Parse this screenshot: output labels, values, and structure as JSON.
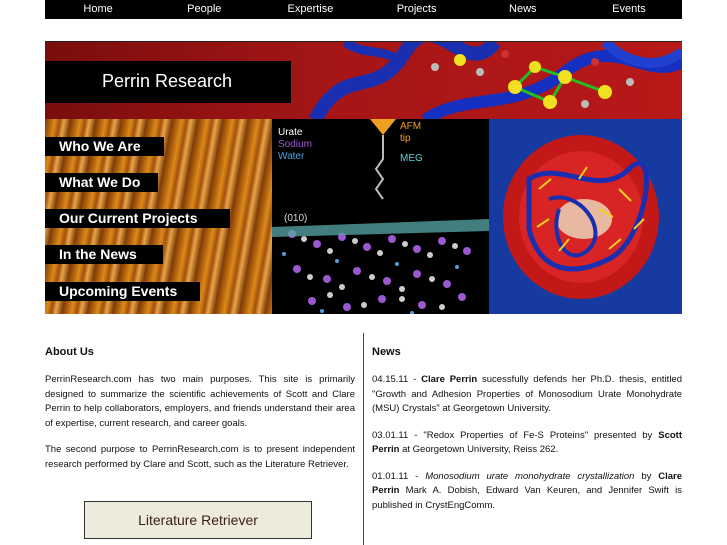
{
  "nav": {
    "items": [
      "Home",
      "People",
      "Expertise",
      "Projects",
      "News",
      "Events"
    ]
  },
  "banner": {
    "title": "Perrin Research"
  },
  "side_menu": {
    "items": [
      "Who We Are",
      "What We Do",
      "Our Current Projects",
      "In the News",
      "Upcoming Events"
    ]
  },
  "figure": {
    "legend": [
      "Urate",
      "Sodium",
      "Water"
    ],
    "afm_label": "AFM",
    "tip_label": "tip",
    "meg_label": "MEG",
    "plane_label": "(010)"
  },
  "about": {
    "heading": "About Us",
    "p1": "PerrinResearch.com has two main purposes. This site is primarily designed to summarize the scientific achievements of Scott and Clare Perrin to help collaborators, employers, and friends understand their area of expertise, current research, and career goals.",
    "p2": "The second purpose to PerrinResearch.com is to present independent research performed by Clare and Scott, such as the Literature Retriever.",
    "button": "Literature Retriever"
  },
  "news": {
    "heading": "News",
    "items": [
      {
        "date": "04.15.11 - ",
        "who": "Clare Perrin",
        "text": " sucessfully defends her Ph.D. thesis, entitled \"Growth and Adhesion Properties of Monosodium Urate Monohydrate (MSU) Crystals\" at Georgetown University."
      },
      {
        "date": "03.01.11 - ",
        "text": "\"Redox Properties of Fe-S Proteins\" presented by ",
        "who": "Scott Perrin",
        "text2": " at Georgetown University, Reiss 262."
      },
      {
        "date": "01.01.11 - ",
        "title": "Monosodium urate monohydrate crystallization",
        "text": "  by ",
        "who": "Clare Perrin",
        "text2": " Mark A. Dobish, Edward Van Keuren, and Jennifer Swift is published in CrystEngComm."
      }
    ]
  },
  "colors": {
    "nav_bg": "#000000",
    "banner_red": "#a51616",
    "urate": "#ffffff",
    "sodium": "#9b59d0",
    "water": "#4aa0e0",
    "afm": "#f0a020",
    "meg": "#5ad0e0"
  }
}
